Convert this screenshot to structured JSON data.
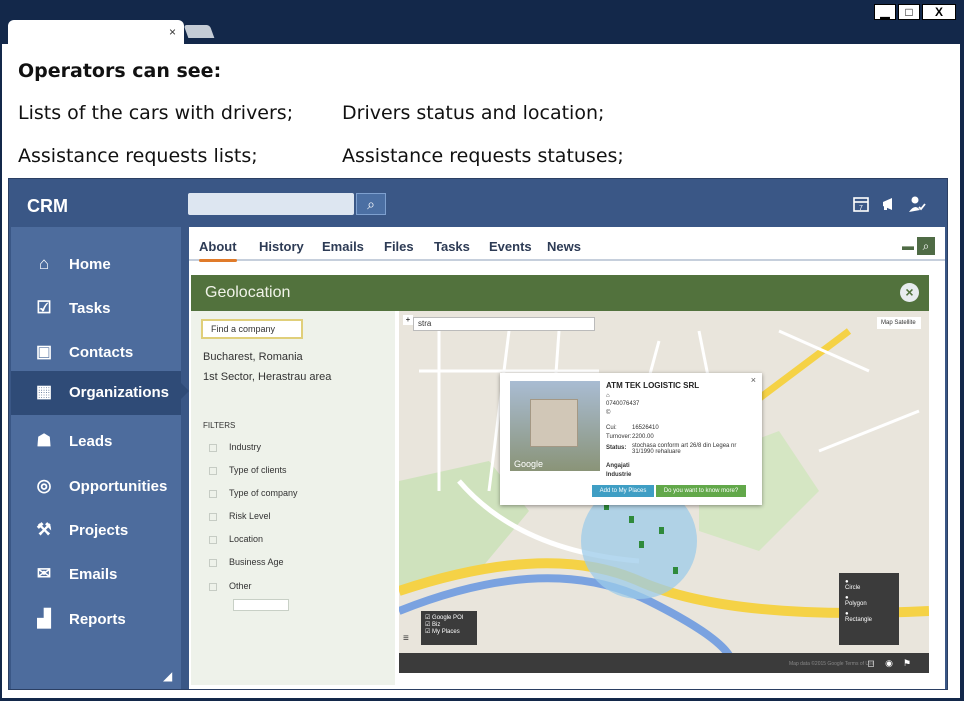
{
  "window": {
    "minimize": "▁",
    "maximize": "□",
    "close": "X",
    "tab_close": "×"
  },
  "intro": {
    "heading": "Operators can see:",
    "lines": [
      "Lists of the cars with drivers;",
      "Drivers status and location;",
      "Assistance requests lists;",
      "Assistance requests statuses;"
    ]
  },
  "app": {
    "brand": "CRM",
    "search_placeholder": "",
    "header_icons": [
      "calendar-icon",
      "megaphone-icon",
      "user-check-icon"
    ],
    "calendar_day": "7"
  },
  "sidebar": {
    "items": [
      {
        "label": "Home",
        "icon": "home-icon",
        "glyph": "⌂"
      },
      {
        "label": "Tasks",
        "icon": "checkbox-icon",
        "glyph": "☑"
      },
      {
        "label": "Contacts",
        "icon": "contacts-icon",
        "glyph": "▣"
      },
      {
        "label": "Organizations",
        "icon": "building-icon",
        "glyph": "▦",
        "active": true
      },
      {
        "label": "Leads",
        "icon": "users-icon",
        "glyph": "☗"
      },
      {
        "label": "Opportunities",
        "icon": "target-icon",
        "glyph": "◎"
      },
      {
        "label": "Projects",
        "icon": "hammer-icon",
        "glyph": "⚒"
      },
      {
        "label": "Emails",
        "icon": "mail-icon",
        "glyph": "✉"
      },
      {
        "label": "Reports",
        "icon": "chart-icon",
        "glyph": "▟"
      }
    ]
  },
  "tabs": [
    {
      "label": "About",
      "active": true
    },
    {
      "label": "History"
    },
    {
      "label": "Emails"
    },
    {
      "label": "Files"
    },
    {
      "label": "Tasks"
    },
    {
      "label": "Events"
    },
    {
      "label": "News"
    }
  ],
  "geo": {
    "title": "Geolocation",
    "close": "×",
    "find_company": "Find a company",
    "city": "Bucharest, Romania",
    "sector": "1st Sector, Herastrau area",
    "filters_title": "FILTERS",
    "filters": [
      "Industry",
      "Type of clients",
      "Type of company",
      "Risk Level",
      "Location",
      "Business Age",
      "Other"
    ]
  },
  "map": {
    "search_value": "stra",
    "type_map": "Map",
    "type_sat": "Satellite",
    "popup": {
      "company": "ATM TEK LOGISTIC SRL",
      "phone": "0740076437",
      "cui_label": "Cui:",
      "cui_value": "16526410",
      "turnover_label": "Turnover:",
      "turnover_value": "2200.00",
      "status_label": "Status:",
      "status_value": "stochasa conform art 26/8 din Legea nr 31/1990 rehaluare",
      "employees_label": "Angajati",
      "industry_label": "Industrie",
      "photo_tag": "Google",
      "add_btn": "Add to My Places",
      "more_btn": "Do you want to know more?"
    },
    "legend": [
      "Google POI",
      "Biz",
      "My Places"
    ],
    "shapes": [
      "Circle",
      "Polygon",
      "Rectangle"
    ],
    "copyright": "Map data ©2015 Google   Terms of Use"
  }
}
